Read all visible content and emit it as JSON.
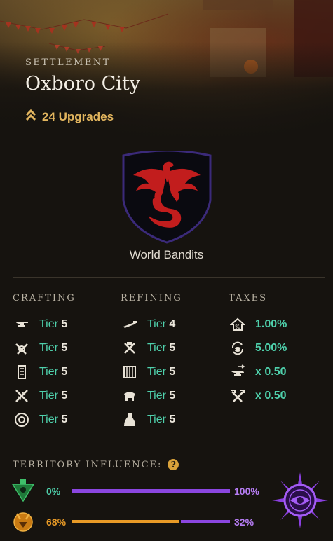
{
  "header": {
    "kicker": "SETTLEMENT",
    "title": "Oxboro City",
    "upgrades_label": "24 Upgrades"
  },
  "company": {
    "name": "World Bandits"
  },
  "columns": {
    "crafting": "CRAFTING",
    "refining": "REFINING",
    "taxes": "TAXES"
  },
  "crafting": [
    {
      "icon": "anvil-icon",
      "prefix": "Tier",
      "value": "5"
    },
    {
      "icon": "crossed-tools-icon",
      "prefix": "Tier",
      "value": "5"
    },
    {
      "icon": "scroll-icon",
      "prefix": "Tier",
      "value": "5"
    },
    {
      "icon": "crossed-swords-icon",
      "prefix": "Tier",
      "value": "5"
    },
    {
      "icon": "arcane-circle-icon",
      "prefix": "Tier",
      "value": "5"
    }
  ],
  "refining": [
    {
      "icon": "saw-icon",
      "prefix": "Tier",
      "value": "4"
    },
    {
      "icon": "smelter-icon",
      "prefix": "Tier",
      "value": "5"
    },
    {
      "icon": "loom-icon",
      "prefix": "Tier",
      "value": "5"
    },
    {
      "icon": "tannery-icon",
      "prefix": "Tier",
      "value": "5"
    },
    {
      "icon": "stonecutting-icon",
      "prefix": "Tier",
      "value": "5"
    }
  ],
  "taxes": [
    {
      "icon": "housing-tax-icon",
      "value": "1.00%"
    },
    {
      "icon": "trading-tax-icon",
      "value": "5.00%"
    },
    {
      "icon": "crafting-fee-icon",
      "value": "x 0.50"
    },
    {
      "icon": "refining-fee-icon",
      "value": "x 0.50"
    }
  ],
  "influence": {
    "label": "TERRITORY INFLUENCE:",
    "help": "?",
    "rows": [
      {
        "faction_icon": "syndicate-icon",
        "left_pct": "0%",
        "right_pct": "100%",
        "left_fraction": 0.0,
        "left_color": "#4fd1ac"
      },
      {
        "faction_icon": "marauders-icon",
        "left_pct": "68%",
        "right_pct": "32%",
        "left_fraction": 0.68,
        "left_color": "#e89a26"
      }
    ],
    "leader_icon": "covenant-eye-icon"
  },
  "colors": {
    "accent_gold": "#e2b55e",
    "tier_green": "#4fd1ac",
    "purple": "#8b46e0",
    "orange": "#e89a26"
  }
}
